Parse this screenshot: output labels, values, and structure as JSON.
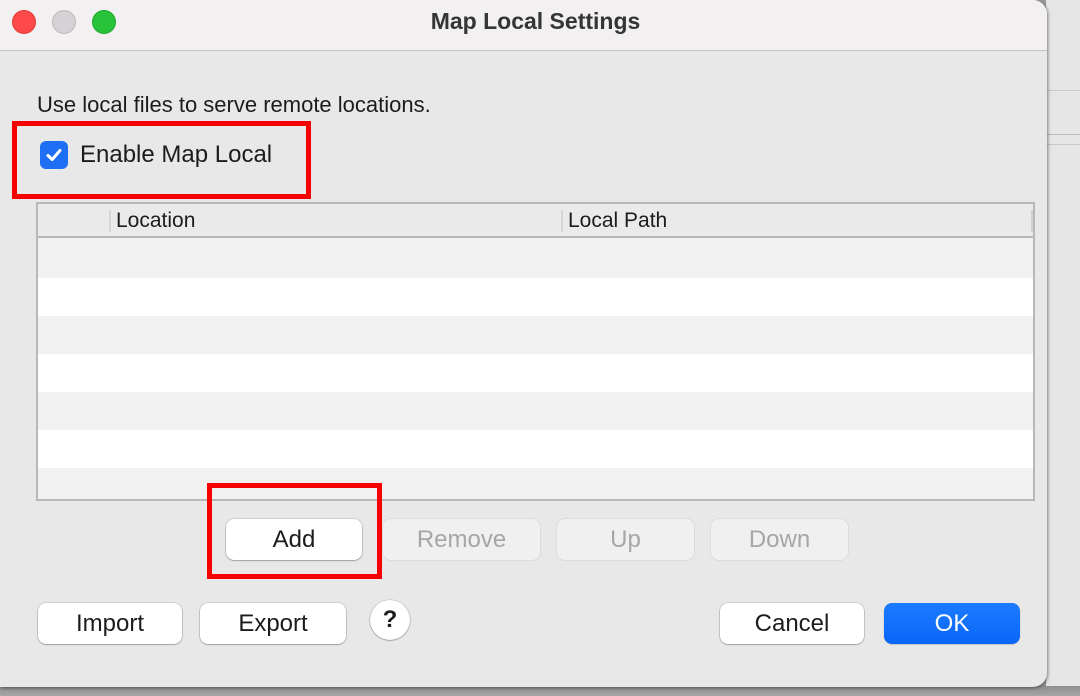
{
  "window": {
    "title": "Map Local Settings",
    "traffic_lights": [
      "close",
      "minimize",
      "zoom"
    ]
  },
  "description": "Use local files to serve remote locations.",
  "enable_checkbox": {
    "label": "Enable Map Local",
    "checked": true
  },
  "table": {
    "columns": [
      "",
      "Location",
      "Local Path"
    ],
    "rows": []
  },
  "table_buttons": {
    "add": "Add",
    "remove": "Remove",
    "up": "Up",
    "down": "Down"
  },
  "footer": {
    "import": "Import",
    "export": "Export",
    "help": "?",
    "cancel": "Cancel",
    "ok": "OK"
  },
  "colors": {
    "accent": "#0a66f7",
    "highlight": "#f60000",
    "close": "#fe4a4a",
    "minimize": "#d5d2d5",
    "zoom": "#29c23b"
  }
}
